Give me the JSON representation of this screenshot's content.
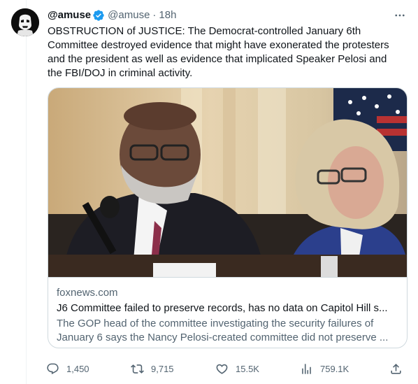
{
  "tweet": {
    "display_name": "@amuse",
    "handle": "@amuse",
    "separator": "·",
    "time": "18h",
    "text": "OBSTRUCTION of JUSTICE: The Democrat-controlled January 6th Committee destroyed evidence that might have exonerated the protesters and the president as well as evidence that implicated Speaker Pelosi and the FBI/DOJ in criminal activity."
  },
  "card": {
    "domain": "foxnews.com",
    "title": "J6 Committee failed to preserve records, has no data on Capitol Hill s...",
    "description": "The GOP head of the committee investigating the security failures of January 6 says the Nancy Pelosi-created committee did not preserve ..."
  },
  "actions": {
    "replies": "1,450",
    "retweets": "9,715",
    "likes": "15.5K",
    "views": "759.1K"
  },
  "colors": {
    "verified": "#1d9bf0",
    "secondary_text": "#536471",
    "border": "#cfd9de"
  },
  "icons": [
    "more-icon",
    "verified-icon",
    "reply-icon",
    "retweet-icon",
    "like-icon",
    "views-icon",
    "share-icon"
  ]
}
